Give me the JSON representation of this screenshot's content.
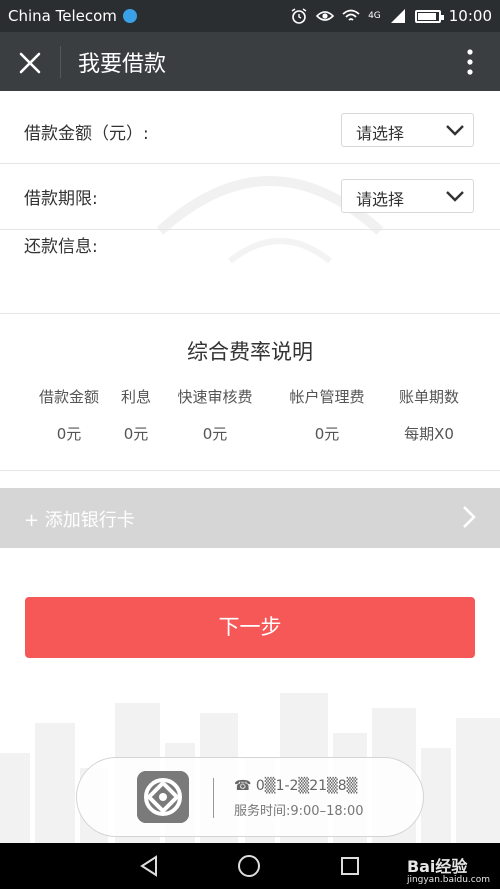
{
  "status_bar": {
    "carrier": "China Telecom",
    "network": "4G",
    "time": "10:00",
    "icons": [
      "alarm-icon",
      "eye-icon",
      "wifi-icon",
      "signal-icon",
      "battery-icon"
    ]
  },
  "toolbar": {
    "title": "我要借款",
    "close_icon": "close-icon",
    "more_icon": "more-vertical-icon"
  },
  "form": {
    "amount_label": "借款金额（元）:",
    "amount_select": "请选择",
    "term_label": "借款期限:",
    "term_select": "请选择",
    "repay_label": "还款信息:"
  },
  "rates": {
    "title": "综合费率说明",
    "columns": [
      {
        "header": "借款金额",
        "value": "0元"
      },
      {
        "header": "利息",
        "value": "0元"
      },
      {
        "header": "快速审核费",
        "value": "0元"
      },
      {
        "header": "帐户管理费",
        "value": "0元"
      },
      {
        "header": "账单期数",
        "value": "每期X0"
      }
    ]
  },
  "add_card": {
    "label": "+ 添加银行卡"
  },
  "next_button": {
    "label": "下一步"
  },
  "service": {
    "phone": "☎ 0▒1-2▒21▒8▒",
    "hours": "服务时间:9:00–18:00"
  },
  "watermark": {
    "brand": "Bai经验",
    "url": "jingyan.baidu.com"
  },
  "colors": {
    "toolbar": "#3b3e41",
    "accent": "#f65858",
    "add_card_bg": "#d6d6d6"
  }
}
